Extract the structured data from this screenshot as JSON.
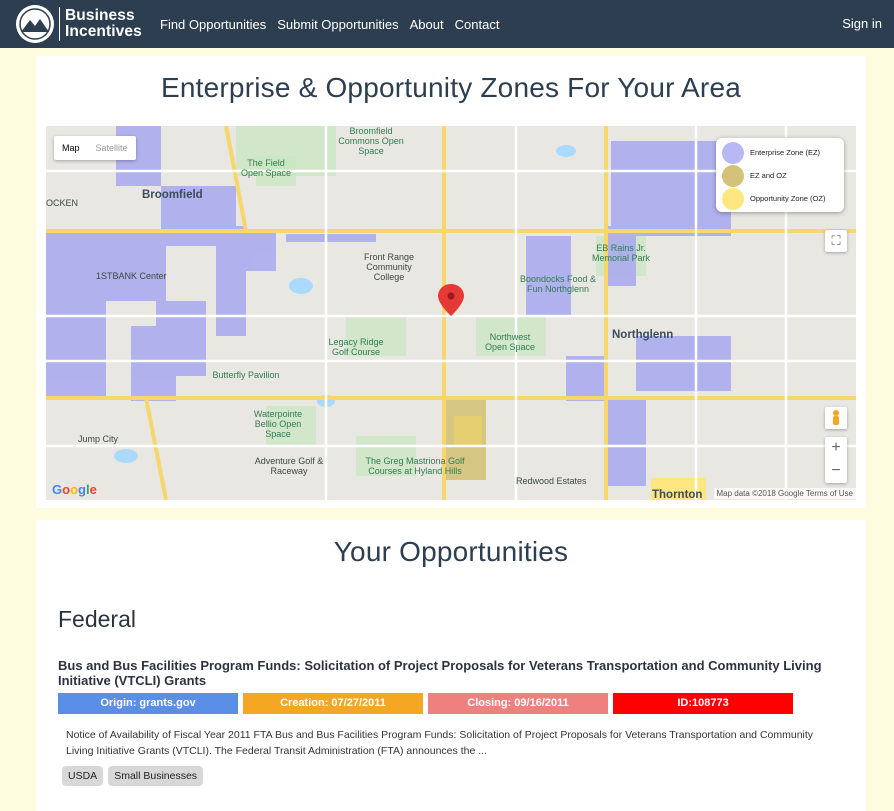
{
  "navbar": {
    "logo_line1": "Business",
    "logo_line2": "Incentives",
    "links": [
      "Find Opportunities",
      "Submit Opportunities",
      "About",
      "Contact"
    ],
    "sign_in": "Sign in",
    "background": "#2c3e50"
  },
  "map_section": {
    "title": "Enterprise & Opportunity Zones For Your Area",
    "map_type": {
      "map": "Map",
      "satellite": "Satellite"
    },
    "legend": [
      {
        "label": "Enterprise Zone (EZ)",
        "color": "#b8b8f5"
      },
      {
        "label": "EZ and OZ",
        "color": "#d4c27a"
      },
      {
        "label": "Opportunity Zone (OZ)",
        "color": "#ffe680"
      }
    ],
    "zoom_in": "+",
    "zoom_out": "−",
    "attribution": "Map data ©2018 Google  Terms of Use",
    "labels": {
      "broomfield": "Broomfield",
      "northglenn": "Northglenn",
      "thornton": "Thornton",
      "front_range": "Front Range Community College",
      "the_field": "The Field Open Space",
      "broomfield_commons": "Broomfield Commons Open Space",
      "legacy_ridge": "Legacy Ridge Golf Course",
      "northwest_os": "Northwest Open Space",
      "boondocks": "Boondocks Food & Fun Northglenn",
      "eb_rains": "EB Rains Jr. Memorial Park",
      "butterfly": "Butterfly Pavilion",
      "waterpointe": "Waterpointe Bellio Open Space",
      "jump_city": "Jump City",
      "adventure_golf": "Adventure Golf & Raceway",
      "greg_mastriona": "The Greg Mastriona Golf Courses at Hyland Hills",
      "redwood": "Redwood Estates",
      "firstbank": "1STBANK Center",
      "ocken": "OCKEN"
    }
  },
  "opportunities": {
    "title": "Your Opportunities",
    "category": "Federal",
    "items": [
      {
        "title": "Bus and Bus Facilities Program Funds: Solicitation of Project Proposals for Veterans Transportation and Community Living Initiative (VTCLI) Grants",
        "origin": "Origin: grants.gov",
        "creation": "Creation: 07/27/2011",
        "closing": "Closing: 09/16/2011",
        "id": "ID:108773",
        "description": "Notice of Availability of Fiscal Year 2011 FTA Bus and Bus Facilities Program Funds: Solicitation of Project Proposals for Veterans Transportation and Community Living Initiative Grants (VTCLI). The Federal Transit Administration (FTA) announces the ...",
        "tags": [
          "USDA",
          "Small Businesses"
        ]
      }
    ],
    "badge_colors": {
      "origin": "#5b8ee6",
      "creation": "#f5a623",
      "closing": "#ee8080",
      "id": "#ff0000"
    }
  }
}
